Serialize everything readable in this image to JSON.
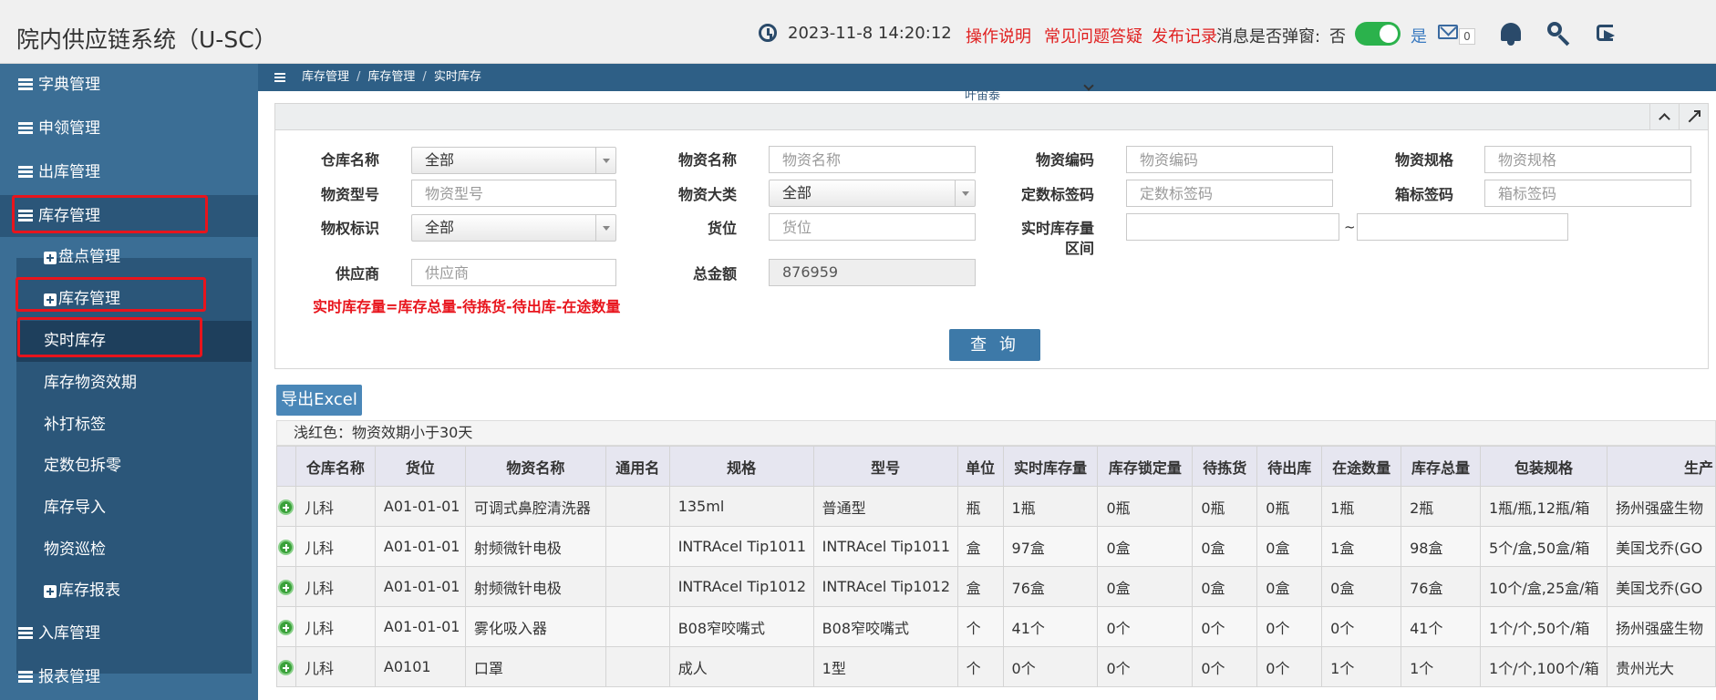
{
  "header": {
    "app_title": "院内供应链系统（U-SC）",
    "datetime": "2023-11-8  14:20:12",
    "links": [
      "操作说明",
      "常见问题答疑",
      "发布记录"
    ],
    "popup_label": "消息是否弹窗:",
    "popup_no": "否",
    "popup_yes": "是",
    "mail_count": "0",
    "toggle_on": true,
    "accent_color": "#e02020"
  },
  "sidebar": {
    "items": [
      {
        "label": "字典管理",
        "icon": "list-icon"
      },
      {
        "label": "申领管理",
        "icon": "list-icon"
      },
      {
        "label": "出库管理",
        "icon": "list-icon"
      },
      {
        "label": "库存管理",
        "icon": "list-icon"
      },
      {
        "label": "入库管理",
        "icon": "list-icon"
      },
      {
        "label": "报表管理",
        "icon": "list-icon"
      }
    ],
    "sub_items": [
      {
        "label": "盘点管理",
        "icon": "plus-square-icon"
      },
      {
        "label": "库存管理",
        "icon": "plus-square-icon"
      },
      {
        "label": "实时库存",
        "active": true
      },
      {
        "label": "库存物资效期"
      },
      {
        "label": "补打标签"
      },
      {
        "label": "定数包拆零"
      },
      {
        "label": "库存导入"
      },
      {
        "label": "物资巡检"
      },
      {
        "label": "库存报表",
        "icon": "plus-square-icon"
      }
    ]
  },
  "breadcrumb": [
    "库存管理",
    "库存管理",
    "实时库存"
  ],
  "ghost_text": "叶宙泰",
  "filters": {
    "warehouse": {
      "label": "仓库名称",
      "value": "全部"
    },
    "material_name": {
      "label": "物资名称",
      "placeholder": "物资名称"
    },
    "material_code": {
      "label": "物资编码",
      "placeholder": "物资编码"
    },
    "material_spec": {
      "label": "物资规格",
      "placeholder": "物资规格"
    },
    "material_model": {
      "label": "物资型号",
      "placeholder": "物资型号"
    },
    "material_category": {
      "label": "物资大类",
      "value": "全部"
    },
    "fixed_tag": {
      "label": "定数标签码",
      "placeholder": "定数标签码"
    },
    "box_tag": {
      "label": "箱标签码",
      "placeholder": "箱标签码"
    },
    "ownership": {
      "label": "物权标识",
      "value": "全部"
    },
    "location": {
      "label": "货位",
      "placeholder": "货位"
    },
    "stock_range": {
      "label_line1": "实时库存量",
      "label_line2": "区间",
      "separator": "~"
    },
    "supplier": {
      "label": "供应商",
      "placeholder": "供应商"
    },
    "total_amount": {
      "label": "总金额",
      "value": "876959"
    },
    "formula_note": "实时库存量=库存总量-待拣货-待出库-在途数量",
    "query_button": "查 询"
  },
  "export_button": "导出Excel",
  "legend_note": "浅红色：物资效期小于30天",
  "table": {
    "columns": [
      "",
      "仓库名称",
      "货位",
      "物资名称",
      "通用名",
      "规格",
      "型号",
      "单位",
      "实时库存量",
      "库存锁定量",
      "待拣货",
      "待出库",
      "在途数量",
      "库存总量",
      "包装规格",
      "生产"
    ],
    "rows": [
      [
        "儿科",
        "A01-01-01",
        "可调式鼻腔清洗器",
        "",
        "135ml",
        "普通型",
        "瓶",
        "1瓶",
        "0瓶",
        "0瓶",
        "0瓶",
        "1瓶",
        "2瓶",
        "1瓶/瓶,12瓶/箱",
        "扬州强盛生物"
      ],
      [
        "儿科",
        "A01-01-01",
        "射频微针电极",
        "",
        "INTRAcel Tip1011",
        "INTRAcel Tip1011",
        "盒",
        "97盒",
        "0盒",
        "0盒",
        "0盒",
        "1盒",
        "98盒",
        "5个/盒,50盒/箱",
        "美国戈乔(GO"
      ],
      [
        "儿科",
        "A01-01-01",
        "射频微针电极",
        "",
        "INTRAcel Tip1012",
        "INTRAcel Tip1012",
        "盒",
        "76盒",
        "0盒",
        "0盒",
        "0盒",
        "0盒",
        "76盒",
        "10个/盒,25盒/箱",
        "美国戈乔(GO"
      ],
      [
        "儿科",
        "A01-01-01",
        "雾化吸入器",
        "",
        "B08窄咬嘴式",
        "B08窄咬嘴式",
        "个",
        "41个",
        "0个",
        "0个",
        "0个",
        "0个",
        "41个",
        "1个/个,50个/箱",
        "扬州强盛生物"
      ],
      [
        "儿科",
        "A0101",
        "口罩",
        "",
        "成人",
        "1型",
        "个",
        "0个",
        "0个",
        "0个",
        "0个",
        "1个",
        "1个",
        "1个/个,100个/箱",
        "贵州光大"
      ]
    ]
  }
}
